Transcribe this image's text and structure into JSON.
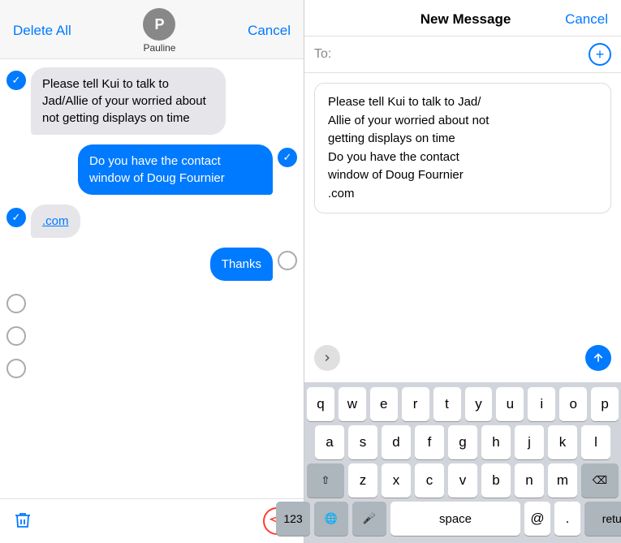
{
  "left": {
    "header": {
      "delete_all": "Delete All",
      "cancel": "Cancel",
      "avatar_initial": "P",
      "contact_name": "Pauline"
    },
    "messages": [
      {
        "id": "msg1",
        "type": "received",
        "checked": true,
        "text": "Please tell Kui to talk to Jad/Allie of your worried about not getting displays on time"
      },
      {
        "id": "msg2",
        "type": "sent",
        "checked": true,
        "text": "Do you have the contact window of Doug Fournier"
      },
      {
        "id": "msg3",
        "type": "received",
        "checked": true,
        "link_text": ".com",
        "prefix_text": ""
      },
      {
        "id": "msg4",
        "type": "sent",
        "checked": false,
        "text": "Thanks"
      },
      {
        "id": "msg5",
        "type": "received",
        "checked": false,
        "text": ""
      },
      {
        "id": "msg6",
        "type": "received",
        "checked": false,
        "text": ""
      },
      {
        "id": "msg7",
        "type": "received",
        "checked": false,
        "text": ""
      }
    ],
    "footer": {
      "trash_label": "trash",
      "forward_label": "forward"
    }
  },
  "right": {
    "header": {
      "title": "New Message",
      "cancel": "Cancel"
    },
    "to_placeholder": "",
    "to_label": "To:",
    "preview": {
      "text": "Please tell Kui to talk to Jad/\nAllie of your worried about not\ngetting displays on time\nDo you have the contact\nwindow of Doug Fournier\n.com"
    },
    "expand_icon": "›",
    "send_icon": "↑"
  },
  "keyboard": {
    "rows": [
      [
        "q",
        "w",
        "e",
        "r",
        "t",
        "y",
        "u",
        "i",
        "o",
        "p"
      ],
      [
        "a",
        "s",
        "d",
        "f",
        "g",
        "h",
        "j",
        "k",
        "l"
      ],
      [
        "⇧",
        "z",
        "x",
        "c",
        "v",
        "b",
        "n",
        "m",
        "⌫"
      ],
      [
        "123",
        "🌐",
        "🎤",
        "space",
        "@",
        ".",
        "return"
      ]
    ]
  }
}
